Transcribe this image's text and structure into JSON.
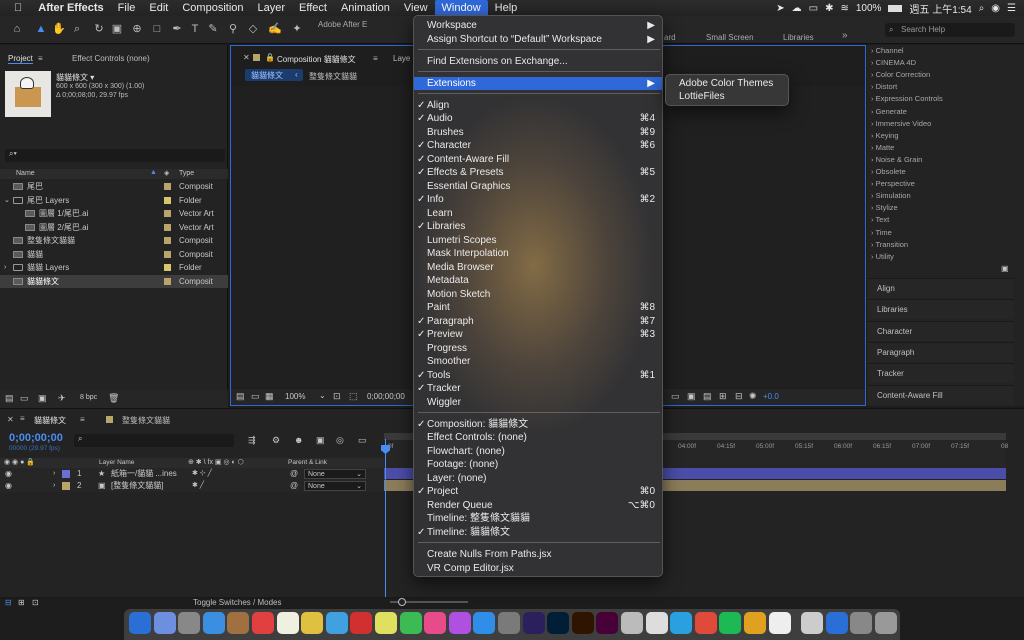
{
  "menubar": {
    "app": "After Effects",
    "items": [
      "File",
      "Edit",
      "Composition",
      "Layer",
      "Effect",
      "Animation",
      "View",
      "Window",
      "Help"
    ],
    "active": "Window",
    "battery": "100%",
    "clock": "週五 上午1:54",
    "window_title": "Adobe After E"
  },
  "toolbar": {
    "workspaces": [
      "ard",
      "Small Screen",
      "Libraries"
    ],
    "search_placeholder": "Search Help"
  },
  "project": {
    "tab_label": "Project",
    "effect_controls_label": "Effect Controls (none)",
    "thumb_name": "貓貓條文 ▾",
    "thumb_info1": "600 x 600  (300 x 300) (1.00)",
    "thumb_info2": "Δ 0;00;08;00, 29.97 fps",
    "columns": {
      "name": "Name",
      "type": "Type"
    },
    "items": [
      {
        "name": "尾巴",
        "type": "Composit",
        "indent": 0,
        "color": "#b9a46a"
      },
      {
        "name": "尾巴 Layers",
        "type": "Folder",
        "indent": 0,
        "color": "#d9c56a"
      },
      {
        "name": "圖層 1/尾巴.ai",
        "type": "Vector Art",
        "indent": 1,
        "color": "#b9a46a"
      },
      {
        "name": "圖層 2/尾巴.ai",
        "type": "Vector Art",
        "indent": 1,
        "color": "#b9a46a"
      },
      {
        "name": "整隻條文貓貓",
        "type": "Composit",
        "indent": 0,
        "color": "#b9a46a"
      },
      {
        "name": "貓貓",
        "type": "Composit",
        "indent": 0,
        "color": "#b9a46a"
      },
      {
        "name": "貓貓 Layers",
        "type": "Folder",
        "indent": 0,
        "color": "#d9c56a"
      },
      {
        "name": "貓貓條文",
        "type": "Composit",
        "indent": 0,
        "color": "#b9a46a"
      }
    ],
    "bpc": "8 bpc"
  },
  "comp": {
    "tab_label": "Composition 貓貓條文",
    "layer_label": "Laye",
    "crumbs": [
      "貓貓條文",
      "整隻條文貓貓"
    ],
    "zoom": "100%",
    "timecode": "0;00;00;00",
    "exposure": "+0.0"
  },
  "window_menu": {
    "items": [
      {
        "label": "Workspace",
        "arrow": true
      },
      {
        "label": "Assign Shortcut to “Default” Workspace",
        "arrow": true
      },
      {
        "sep": true
      },
      {
        "label": "Find Extensions on Exchange..."
      },
      {
        "sep": true
      },
      {
        "label": "Extensions",
        "arrow": true,
        "hl": true
      },
      {
        "sep": true
      },
      {
        "label": "Align",
        "check": true
      },
      {
        "label": "Audio",
        "check": true,
        "sc": "⌘4"
      },
      {
        "label": "Brushes",
        "sc": "⌘9"
      },
      {
        "label": "Character",
        "check": true,
        "sc": "⌘6"
      },
      {
        "label": "Content-Aware Fill",
        "check": true
      },
      {
        "label": "Effects & Presets",
        "check": true,
        "sc": "⌘5"
      },
      {
        "label": "Essential Graphics"
      },
      {
        "label": "Info",
        "check": true,
        "sc": "⌘2"
      },
      {
        "label": "Learn"
      },
      {
        "label": "Libraries",
        "check": true
      },
      {
        "label": "Lumetri Scopes"
      },
      {
        "label": "Mask Interpolation"
      },
      {
        "label": "Media Browser"
      },
      {
        "label": "Metadata"
      },
      {
        "label": "Motion Sketch"
      },
      {
        "label": "Paint",
        "sc": "⌘8"
      },
      {
        "label": "Paragraph",
        "check": true,
        "sc": "⌘7"
      },
      {
        "label": "Preview",
        "check": true,
        "sc": "⌘3"
      },
      {
        "label": "Progress"
      },
      {
        "label": "Smoother"
      },
      {
        "label": "Tools",
        "check": true,
        "sc": "⌘1"
      },
      {
        "label": "Tracker",
        "check": true
      },
      {
        "label": "Wiggler"
      },
      {
        "sep": true
      },
      {
        "label": "Composition: 貓貓條文",
        "check": true
      },
      {
        "label": "Effect Controls: (none)"
      },
      {
        "label": "Flowchart: (none)"
      },
      {
        "label": "Footage: (none)"
      },
      {
        "label": "Layer: (none)"
      },
      {
        "label": "Project",
        "check": true,
        "sc": "⌘0"
      },
      {
        "label": "Render Queue",
        "sc": "⌥⌘0"
      },
      {
        "label": "Timeline: 整隻條文貓貓"
      },
      {
        "label": "Timeline: 貓貓條文",
        "check": true
      },
      {
        "sep": true
      },
      {
        "label": "Create Nulls From Paths.jsx"
      },
      {
        "label": "VR Comp Editor.jsx"
      }
    ]
  },
  "extensions_menu": [
    "Adobe Color Themes",
    "LottieFiles"
  ],
  "effects_list": [
    "Channel",
    "CINEMA 4D",
    "Color Correction",
    "Distort",
    "Expression Controls",
    "Generate",
    "Immersive Video",
    "Keying",
    "Matte",
    "Noise & Grain",
    "Obsolete",
    "Perspective",
    "Simulation",
    "Stylize",
    "Text",
    "Time",
    "Transition",
    "Utility"
  ],
  "right_panels": [
    "Align",
    "Libraries",
    "Character",
    "Paragraph",
    "Tracker",
    "Content-Aware Fill"
  ],
  "timeline": {
    "tabs": [
      "貓貓條文",
      "整隻條文貓貓"
    ],
    "timecode": "0;00;00;00",
    "fps": "00000 (29.97 fps)",
    "col_layer": "Layer Name",
    "col_parent": "Parent & Link",
    "layers": [
      {
        "num": "1",
        "name": "紙箱一/貓貓 ...ines",
        "parent": "None",
        "color": "#6a6fd8"
      },
      {
        "num": "2",
        "name": "[整隻條文貓貓]",
        "parent": "None",
        "color": "#b9a46a"
      }
    ],
    "ruler": [
      "0f",
      "04:00f",
      "04:15f",
      "05:00f",
      "05:15f",
      "06:00f",
      "06:15f",
      "07:00f",
      "07:15f",
      "08"
    ],
    "toggle": "Toggle Switches / Modes"
  }
}
